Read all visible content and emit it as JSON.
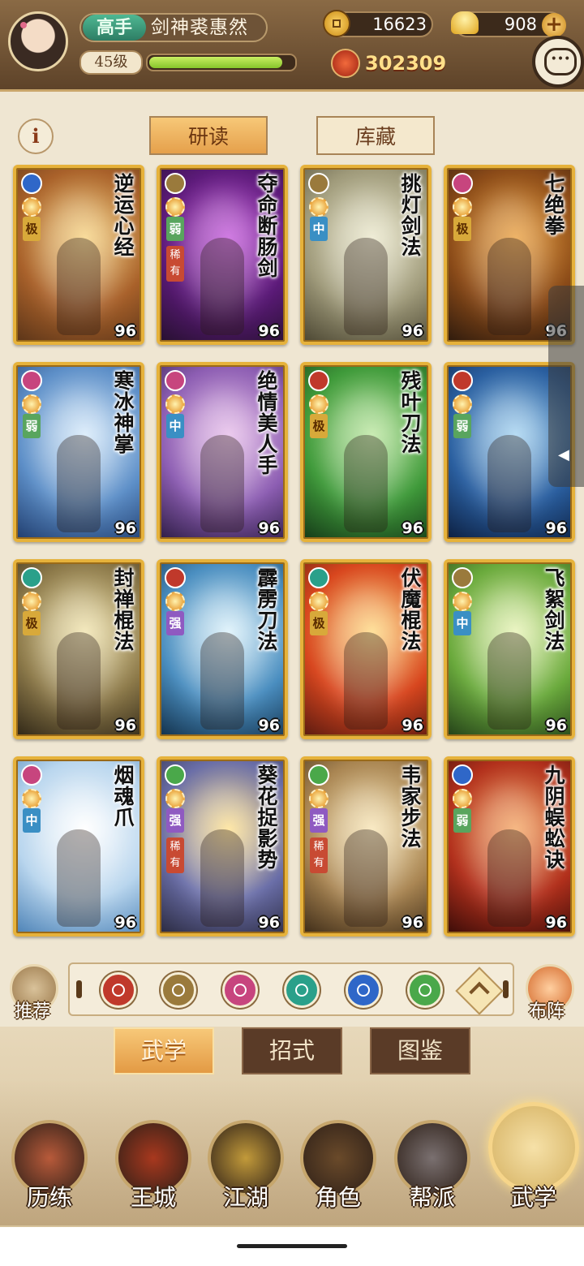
{
  "header": {
    "rank": "高手",
    "player_name": "剑神裘惠然",
    "level": "45级",
    "exp_fraction": 0.92,
    "coins": "16623",
    "gold": "908",
    "plus": "+",
    "power": "302309",
    "info": "i"
  },
  "subtabs": {
    "active": "研读",
    "inactive": "库藏"
  },
  "cards": [
    {
      "name": "逆运心经",
      "grade": "极",
      "rare": "",
      "level": "96",
      "bg": [
        "#f6d07a",
        "#a9612a",
        "#5a3418"
      ],
      "school": "#2f67c8"
    },
    {
      "name": "夺命断肠剑",
      "grade": "弱",
      "rare": "稀有",
      "level": "96",
      "bg": [
        "#c04fd8",
        "#5b1a78",
        "#26102f"
      ],
      "school": "#9a7a3c"
    },
    {
      "name": "挑灯剑法",
      "grade": "中",
      "rare": "",
      "level": "96",
      "bg": [
        "#e9e6c8",
        "#9f9a7a",
        "#4b4632"
      ],
      "school": "#9a7a3c"
    },
    {
      "name": "七绝拳",
      "grade": "极",
      "rare": "",
      "level": "96",
      "bg": [
        "#e89a35",
        "#8a4a18",
        "#2d1a0d"
      ],
      "school": "#c7457e"
    },
    {
      "name": "寒冰神掌",
      "grade": "弱",
      "rare": "",
      "level": "96",
      "bg": [
        "#d3e8fa",
        "#5d8fc8",
        "#203d6e"
      ],
      "school": "#c7457e"
    },
    {
      "name": "绝情美人手",
      "grade": "中",
      "rare": "",
      "level": "96",
      "bg": [
        "#e5b9e8",
        "#8d5eb3",
        "#2e1d46"
      ],
      "school": "#c7457e"
    },
    {
      "name": "残叶刀法",
      "grade": "极",
      "rare": "",
      "level": "96",
      "bg": [
        "#b7e59a",
        "#3f9a3a",
        "#153a18"
      ],
      "school": "#c0392b"
    },
    {
      "name": "",
      "grade": "弱",
      "rare": "",
      "level": "96",
      "bg": [
        "#9fd0f0",
        "#2a5fa0",
        "#0c1f40"
      ],
      "school": "#c0392b"
    },
    {
      "name": "封禅棍法",
      "grade": "极",
      "rare": "",
      "level": "96",
      "bg": [
        "#f0e2a8",
        "#8d7a4a",
        "#2f2616"
      ],
      "school": "#2aa08a"
    },
    {
      "name": "霹雳刀法",
      "grade": "强",
      "rare": "",
      "level": "96",
      "bg": [
        "#d8f0fa",
        "#4a8ec0",
        "#12304a"
      ],
      "school": "#c0392b"
    },
    {
      "name": "伏魔棍法",
      "grade": "极",
      "rare": "",
      "level": "96",
      "bg": [
        "#ffd77a",
        "#d8461e",
        "#5a1a10"
      ],
      "school": "#2aa08a"
    },
    {
      "name": "飞絮剑法",
      "grade": "中",
      "rare": "",
      "level": "96",
      "bg": [
        "#e5f2b0",
        "#6aaa3c",
        "#234018"
      ],
      "school": "#9a7a3c"
    },
    {
      "name": "烟魂爪",
      "grade": "中",
      "rare": "",
      "level": "96",
      "bg": [
        "#ffffff",
        "#b9d6ee",
        "#4c82b6"
      ],
      "school": "#c7457e"
    },
    {
      "name": "葵花捉影势",
      "grade": "强",
      "rare": "稀有",
      "level": "96",
      "bg": [
        "#ffe08a",
        "#6a6ea8",
        "#2a2a40"
      ],
      "school": "#4aa84a"
    },
    {
      "name": "韦家步法",
      "grade": "强",
      "rare": "稀有",
      "level": "96",
      "bg": [
        "#f7e3b0",
        "#a98552",
        "#3e2c18"
      ],
      "school": "#4aa84a"
    },
    {
      "name": "九阴蜈蚣诀",
      "grade": "弱",
      "rare": "",
      "level": "96",
      "bg": [
        "#f3a05a",
        "#b2301c",
        "#3a0c08"
      ],
      "school": "#2f67c8"
    }
  ],
  "filter": {
    "recommend": "推荐",
    "formation": "布阵",
    "schools": [
      "#c0392b",
      "#9a7a3c",
      "#c7457e",
      "#2aa08a",
      "#2f67c8",
      "#4aa84a"
    ]
  },
  "lower_tabs": [
    "武学",
    "招式",
    "图鉴"
  ],
  "nav": [
    {
      "label": "历练",
      "color": "#b85a3a"
    },
    {
      "label": "王城",
      "color": "#a8381e"
    },
    {
      "label": "江湖",
      "color": "#c29a3a"
    },
    {
      "label": "角色",
      "color": "#6a4a2a"
    },
    {
      "label": "帮派",
      "color": "#7a7070"
    },
    {
      "label": "武学",
      "color": "#d4b060"
    }
  ]
}
